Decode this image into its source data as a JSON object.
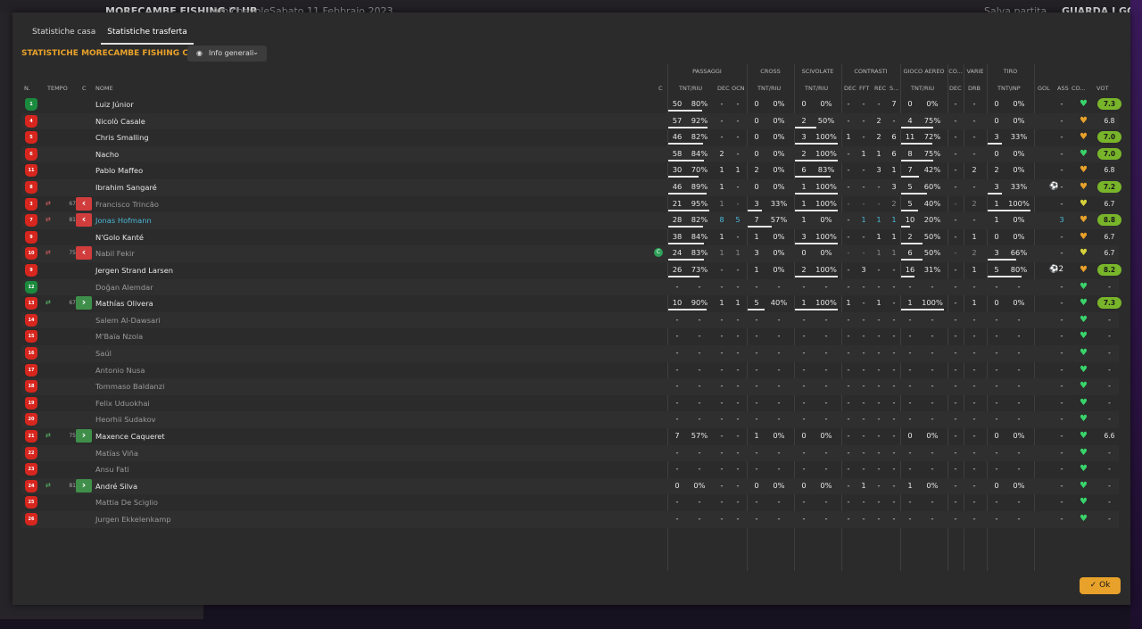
{
  "background": {
    "match": "MORECAMBE FISHING CLUB",
    "event": "Amichevole",
    "date": "Sabato 11 Febbraio 2023",
    "save_label": "Salva partita",
    "watch_label": "GUARDA I GOL"
  },
  "tabs": [
    "Statistiche casa",
    "Statistiche trasferta"
  ],
  "active_tab": 1,
  "title": "STATISTICHE MORECAMBE FISHING CLUB",
  "view_dropdown": "Info generali",
  "group_headers": {
    "passaggi": "PASSAGGI",
    "cross": "CROSS",
    "scivolate": "SCIVOLATE",
    "contrasti": "CONTRASTI",
    "gioco_aereo": "GIOCO AEREO",
    "co": "CO...",
    "varie": "VARIE",
    "tiro": "TIRO"
  },
  "col_headers": {
    "n": "N.",
    "tempo": "TEMPO",
    "c": "C",
    "nome": "NOME",
    "c2": "C",
    "pass": "TNT/RIU",
    "pdec": "DEC",
    "ocn": "OCN",
    "cross": "TNT/RIU",
    "sciv": "TNT/RIU",
    "cdec": "DEC",
    "fft": "FFT",
    "rec": "REC",
    "s": "S...",
    "aereo": "TNT/RIU",
    "codec": "DEC",
    "drb": "DRB",
    "tiro": "TNT\\INP",
    "gol": "GOL",
    "ass": "ASS",
    "co": "CO...",
    "vot": "VOT"
  },
  "players": [
    {
      "num": "1",
      "gk": true,
      "name": "Luiz Júnior",
      "active": true,
      "pass": [
        "50",
        "80%",
        0.8
      ],
      "pdec": "-",
      "ocn": "-",
      "cross": [
        "0",
        "0%",
        0
      ],
      "sciv": [
        "0",
        "0%",
        0
      ],
      "cdec": "-",
      "fft": "-",
      "rec": "-",
      "s": "7",
      "aereo": [
        "0",
        "0%",
        0
      ],
      "codec": "-",
      "drb": "-",
      "tiro": [
        "0",
        "0%",
        0
      ],
      "gol": "",
      "ass": "-",
      "mood": "green",
      "vot": "7.3",
      "votg": true
    },
    {
      "num": "4",
      "name": "Nicolò Casale",
      "active": true,
      "pass": [
        "57",
        "92%",
        0.92
      ],
      "pdec": "-",
      "ocn": "-",
      "cross": [
        "0",
        "0%",
        0
      ],
      "sciv": [
        "2",
        "50%",
        0.5
      ],
      "cdec": "-",
      "fft": "-",
      "rec": "2",
      "s": "-",
      "aereo": [
        "4",
        "75%",
        0.75
      ],
      "codec": "-",
      "drb": "-",
      "tiro": [
        "0",
        "0%",
        0
      ],
      "gol": "",
      "ass": "-",
      "mood": "orange",
      "vot": "6.8"
    },
    {
      "num": "5",
      "name": "Chris Smalling",
      "active": true,
      "pass": [
        "46",
        "82%",
        0.82
      ],
      "pdec": "-",
      "ocn": "-",
      "cross": [
        "0",
        "0%",
        0
      ],
      "sciv": [
        "3",
        "100%",
        1
      ],
      "cdec": "1",
      "fft": "-",
      "rec": "2",
      "s": "6",
      "aereo": [
        "11",
        "72%",
        0.72
      ],
      "codec": "-",
      "drb": "-",
      "tiro": [
        "3",
        "33%",
        0.33
      ],
      "gol": "",
      "ass": "-",
      "mood": "orange",
      "vot": "7.0",
      "votg": true
    },
    {
      "num": "6",
      "name": "Nacho",
      "active": true,
      "pass": [
        "58",
        "84%",
        0.84
      ],
      "pdec": "2",
      "ocn": "-",
      "cross": [
        "0",
        "0%",
        0
      ],
      "sciv": [
        "2",
        "100%",
        1
      ],
      "cdec": "-",
      "fft": "1",
      "rec": "1",
      "s": "6",
      "aereo": [
        "8",
        "75%",
        0.75
      ],
      "codec": "-",
      "drb": "-",
      "tiro": [
        "0",
        "0%",
        0
      ],
      "gol": "",
      "ass": "-",
      "mood": "green",
      "vot": "7.0",
      "votg": true
    },
    {
      "num": "11",
      "name": "Pablo Maffeo",
      "active": true,
      "pass": [
        "30",
        "70%",
        0.7
      ],
      "pdec": "1",
      "ocn": "1",
      "cross": [
        "2",
        "0%",
        0
      ],
      "sciv": [
        "6",
        "83%",
        0.83
      ],
      "cdec": "-",
      "fft": "-",
      "rec": "3",
      "s": "1",
      "aereo": [
        "7",
        "42%",
        0.42
      ],
      "codec": "-",
      "drb": "2",
      "tiro": [
        "2",
        "0%",
        0
      ],
      "gol": "",
      "ass": "-",
      "mood": "orange",
      "vot": "6.8"
    },
    {
      "num": "8",
      "name": "Ibrahim Sangaré",
      "active": true,
      "pass": [
        "46",
        "89%",
        0.89
      ],
      "pdec": "1",
      "ocn": "-",
      "cross": [
        "0",
        "0%",
        0
      ],
      "sciv": [
        "1",
        "100%",
        1
      ],
      "cdec": "-",
      "fft": "-",
      "rec": "-",
      "s": "3",
      "aereo": [
        "5",
        "60%",
        0.6
      ],
      "codec": "-",
      "drb": "-",
      "tiro": [
        "3",
        "33%",
        0.33
      ],
      "gol": "ball",
      "ass": "-",
      "mood": "orange",
      "vot": "7.2",
      "votg": true
    },
    {
      "num": "3",
      "name": "Francisco Trincão",
      "active": false,
      "sub": "out",
      "time": "67",
      "pass": [
        "21",
        "95%",
        0.95
      ],
      "pdec": "1",
      "ocn": "-",
      "cross": [
        "3",
        "33%",
        0.33
      ],
      "sciv": [
        "1",
        "100%",
        1
      ],
      "cdec": "-",
      "fft": "-",
      "rec": "-",
      "s": "2",
      "aereo": [
        "5",
        "40%",
        0.4
      ],
      "codec": "-",
      "drb": "2",
      "tiro": [
        "1",
        "100%",
        1
      ],
      "gol": "",
      "ass": "-",
      "mood": "yellow",
      "vot": "6.7",
      "dimstats": true
    },
    {
      "num": "7",
      "name": "Jonas Hofmann",
      "active": true,
      "hl": true,
      "sub": "out",
      "time": "81",
      "pass": [
        "28",
        "82%",
        0.82
      ],
      "pdec": "8",
      "ocn": "5",
      "cross": [
        "7",
        "57%",
        0.57
      ],
      "sciv": [
        "1",
        "0%",
        0
      ],
      "cdec": "-",
      "fft": "1",
      "rec": "1",
      "s": "1",
      "aereo": [
        "10",
        "20%",
        0.2
      ],
      "codec": "-",
      "drb": "-",
      "tiro": [
        "1",
        "0%",
        0
      ],
      "gol": "",
      "ass": "3",
      "mood": "orange",
      "vot": "8.8",
      "votg": true,
      "bluestats": true
    },
    {
      "num": "9",
      "name": "N'Golo Kanté",
      "active": true,
      "pass": [
        "38",
        "84%",
        0.84
      ],
      "pdec": "1",
      "ocn": "-",
      "cross": [
        "1",
        "0%",
        0
      ],
      "sciv": [
        "3",
        "100%",
        1
      ],
      "cdec": "-",
      "fft": "-",
      "rec": "1",
      "s": "1",
      "aereo": [
        "2",
        "50%",
        0.5
      ],
      "codec": "-",
      "drb": "1",
      "tiro": [
        "0",
        "0%",
        0
      ],
      "gol": "",
      "ass": "-",
      "mood": "orange",
      "vot": "6.7"
    },
    {
      "num": "10",
      "name": "Nabil Fekir",
      "active": false,
      "sub": "out",
      "time": "75",
      "cap": true,
      "pass": [
        "24",
        "83%",
        0.83
      ],
      "pdec": "1",
      "ocn": "1",
      "cross": [
        "3",
        "0%",
        0
      ],
      "sciv": [
        "0",
        "0%",
        0
      ],
      "cdec": "-",
      "fft": "-",
      "rec": "1",
      "s": "1",
      "aereo": [
        "6",
        "50%",
        0.5
      ],
      "codec": "-",
      "drb": "2",
      "tiro": [
        "3",
        "66%",
        0.66
      ],
      "gol": "",
      "ass": "-",
      "mood": "yellow",
      "vot": "6.7",
      "dimstats": true
    },
    {
      "num": "9",
      "name": "Jergen Strand Larsen",
      "active": true,
      "pass": [
        "26",
        "73%",
        0.73
      ],
      "pdec": "-",
      "ocn": "-",
      "cross": [
        "1",
        "0%",
        0
      ],
      "sciv": [
        "2",
        "100%",
        1
      ],
      "cdec": "-",
      "fft": "3",
      "rec": "-",
      "s": "-",
      "aereo": [
        "16",
        "31%",
        0.31
      ],
      "codec": "-",
      "drb": "1",
      "tiro": [
        "5",
        "80%",
        0.8
      ],
      "gol": "ball2",
      "ass": "",
      "mood": "orange",
      "vot": "8.2",
      "votg": true
    },
    {
      "num": "12",
      "gk": true,
      "name": "Doğan Alemdar",
      "active": false,
      "empty": true,
      "mood": "green",
      "vot": "-"
    },
    {
      "num": "13",
      "name": "Mathías Olivera",
      "active": true,
      "sub": "in",
      "time": "67",
      "pass": [
        "10",
        "90%",
        0.9
      ],
      "pdec": "1",
      "ocn": "1",
      "cross": [
        "5",
        "40%",
        0.4
      ],
      "sciv": [
        "1",
        "100%",
        1
      ],
      "cdec": "1",
      "fft": "-",
      "rec": "1",
      "s": "-",
      "aereo": [
        "1",
        "100%",
        1
      ],
      "codec": "-",
      "drb": "1",
      "tiro": [
        "0",
        "0%",
        0
      ],
      "gol": "",
      "ass": "-",
      "mood": "green",
      "vot": "7.3",
      "votg": true
    },
    {
      "num": "14",
      "name": "Salem Al-Dawsari",
      "active": false,
      "empty": true,
      "mood": "green",
      "vot": "-"
    },
    {
      "num": "15",
      "name": "M'Baïa Nzola",
      "active": false,
      "empty": true,
      "mood": "green",
      "vot": "-"
    },
    {
      "num": "16",
      "name": "Saúl",
      "active": false,
      "empty": true,
      "mood": "green",
      "vot": "-"
    },
    {
      "num": "17",
      "name": "Antonio Nusa",
      "active": false,
      "empty": true,
      "mood": "green",
      "vot": "-"
    },
    {
      "num": "18",
      "name": "Tommaso Baldanzi",
      "active": false,
      "empty": true,
      "mood": "green",
      "vot": "-"
    },
    {
      "num": "19",
      "name": "Felix Uduokhai",
      "active": false,
      "empty": true,
      "mood": "green",
      "vot": "-"
    },
    {
      "num": "20",
      "name": "Heorhii Sudakov",
      "active": false,
      "empty": true,
      "mood": "green",
      "vot": "-"
    },
    {
      "num": "21",
      "name": "Maxence Caqueret",
      "active": true,
      "sub": "in",
      "time": "75",
      "pass": [
        "7",
        "57%",
        0.57
      ],
      "pdec": "-",
      "ocn": "-",
      "cross": [
        "1",
        "0%",
        0
      ],
      "sciv": [
        "0",
        "0%",
        0
      ],
      "cdec": "-",
      "fft": "-",
      "rec": "-",
      "s": "-",
      "aereo": [
        "0",
        "0%",
        0
      ],
      "codec": "-",
      "drb": "-",
      "tiro": [
        "0",
        "0%",
        0
      ],
      "gol": "",
      "ass": "-",
      "mood": "green",
      "vot": "6.6",
      "nobars": true
    },
    {
      "num": "22",
      "name": "Matías Viña",
      "active": false,
      "empty": true,
      "mood": "green",
      "vot": "-"
    },
    {
      "num": "23",
      "name": "Ansu Fati",
      "active": false,
      "empty": true,
      "mood": "green",
      "vot": "-"
    },
    {
      "num": "24",
      "name": "André Silva",
      "active": true,
      "sub": "in",
      "time": "81",
      "pass": [
        "0",
        "0%",
        0
      ],
      "pdec": "-",
      "ocn": "-",
      "cross": [
        "0",
        "0%",
        0
      ],
      "sciv": [
        "0",
        "0%",
        0
      ],
      "cdec": "-",
      "fft": "1",
      "rec": "-",
      "s": "-",
      "aereo": [
        "1",
        "0%",
        0
      ],
      "codec": "-",
      "drb": "-",
      "tiro": [
        "0",
        "0%",
        0
      ],
      "gol": "",
      "ass": "-",
      "mood": "green",
      "vot": "-",
      "nobars": true
    },
    {
      "num": "25",
      "name": "Mattia De Sciglio",
      "active": false,
      "empty": true,
      "mood": "green",
      "vot": "-"
    },
    {
      "num": "26",
      "name": "Jurgen Ekkelenkamp",
      "active": false,
      "empty": true,
      "mood": "green",
      "vot": "-"
    }
  ],
  "ok_label": "Ok",
  "colors": {
    "accent": "#e8a12a",
    "vot_good": "#79b52a",
    "shirt": "#d7261e",
    "gk_shirt": "#1b8a3e",
    "highlight": "#4ab6d6"
  }
}
